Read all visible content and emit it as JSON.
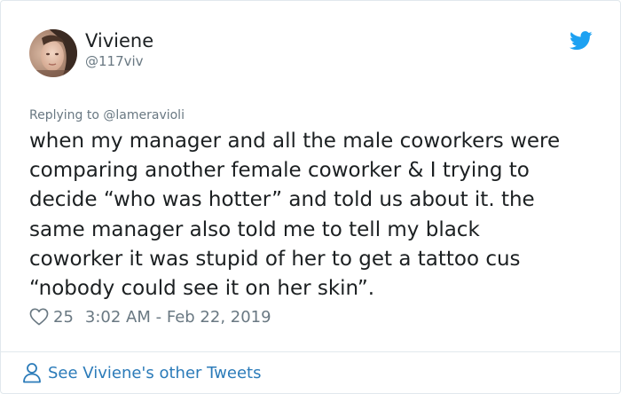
{
  "author": {
    "display_name": "Viviene",
    "handle": "@117viv"
  },
  "tweet": {
    "reply_prefix": "Replying to ",
    "reply_to": "@lameravioli",
    "text_lines": [
      "when my manager and all the male coworkers were",
      "comparing another female coworker & I trying to",
      "decide “who was hotter” and told us about it. the",
      "same manager also told me to tell my black",
      "coworker it was stupid of her to get a tattoo cus",
      "“nobody could see it on her skin”."
    ],
    "like_count": "25",
    "timestamp": "3:02 AM - Feb 22, 2019"
  },
  "footer": {
    "see_more_label": "See Viviene's other Tweets"
  },
  "icons": {
    "brand": "twitter-bird-icon",
    "like": "heart-icon",
    "profile": "person-icon"
  },
  "colors": {
    "brand_blue": "#1da1f2",
    "link_blue": "#2b7bb9",
    "text": "#1c2022",
    "muted": "#697882",
    "border": "#e1e8ed"
  }
}
